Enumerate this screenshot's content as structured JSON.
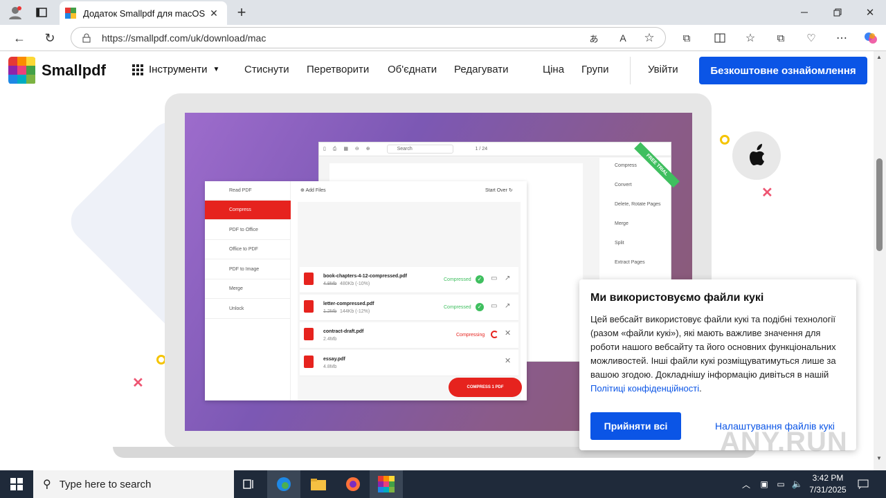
{
  "browser": {
    "tab_title": "Додаток Smallpdf для macOS",
    "url": "https://smallpdf.com/uk/download/mac"
  },
  "site": {
    "logo_text": "Smallpdf",
    "nav": {
      "tools": "Інструменти",
      "compress": "Стиснути",
      "convert": "Перетворити",
      "merge": "Об'єднати",
      "edit": "Редагувати",
      "price": "Ціна",
      "teams": "Групи",
      "login": "Увійти",
      "trial": "Безкоштовне ознайомлення"
    }
  },
  "mock_app": {
    "toolbar_search": "Search",
    "page_indicator": "1 / 24",
    "ribbon": "FREE TRIAL",
    "sidebar": [
      "Read PDF",
      "Compress",
      "PDF to Office",
      "Office to PDF",
      "PDF to Image",
      "Merge",
      "Unlock"
    ],
    "add_files": "Add Files",
    "start_over": "Start Over",
    "files": [
      {
        "name": "book-chapters-4-12-compressed.pdf",
        "old": "4.8Mb",
        "new": "480Kb (-10%)",
        "status": "Compressed"
      },
      {
        "name": "letter-compressed.pdf",
        "old": "1.2Mb",
        "new": "144Kb (-12%)",
        "status": "Compressed"
      },
      {
        "name": "contract-draft.pdf",
        "size": "2.4Mb",
        "status": "Compressing"
      },
      {
        "name": "essay.pdf",
        "size": "4.8Mb",
        "status": ""
      }
    ],
    "compress_btn": "COMPRESS 1 PDF",
    "right_menu": [
      "Compress",
      "Convert",
      "Delete, Rotate Pages",
      "Merge",
      "Split",
      "Extract Pages"
    ]
  },
  "cookie": {
    "title": "Ми використовуємо файли кукі",
    "body": "Цей вебсайт використовує файли кукі та подібні технології (разом «файли кукі»), які мають важливе значення для роботи нашого вебсайту та його основних функціональних можливостей. Інші файли кукі розміщуватимуться лише за вашою згодою. Докладнішу інформацію дивіться в нашій",
    "link": "Політиці конфіденційності",
    "accept": "Прийняти всі",
    "settings": "Налаштування файлів кукі"
  },
  "taskbar": {
    "search_placeholder": "Type here to search",
    "time": "3:42 PM",
    "date": "7/31/2025"
  },
  "watermark": "ANY.RUN",
  "colors": {
    "accent": "#0b55e6",
    "red": "#e6231e",
    "green": "#3fbf5f"
  }
}
